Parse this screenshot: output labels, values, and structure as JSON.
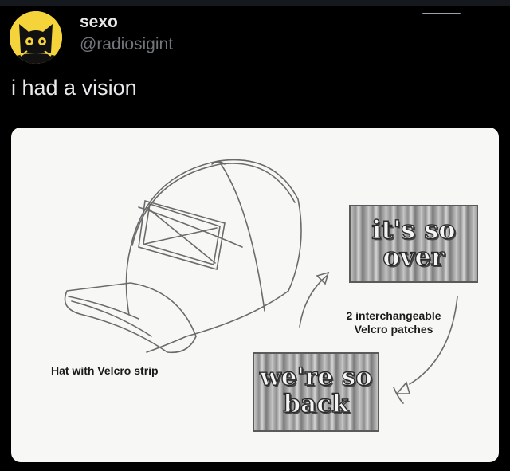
{
  "author": {
    "display_name": "sexo",
    "handle": "@radiosigint",
    "avatar_icon": "black-cat-avatar-icon"
  },
  "tweet": {
    "text": "i had a vision"
  },
  "media": {
    "hat_label": "Hat with Velcro strip",
    "patches_label_line1": "2 interchangeable",
    "patches_label_line2": "Velcro patches",
    "patch_over_line1": "it's so",
    "patch_over_line2": "over",
    "patch_back_line1": "we're so",
    "patch_back_line2": "back"
  },
  "colors": {
    "background": "#000000",
    "text_primary": "#e7e9ea",
    "text_secondary": "#71767b",
    "avatar_yellow": "#f5d33a",
    "card_background": "#f7f7f5"
  }
}
